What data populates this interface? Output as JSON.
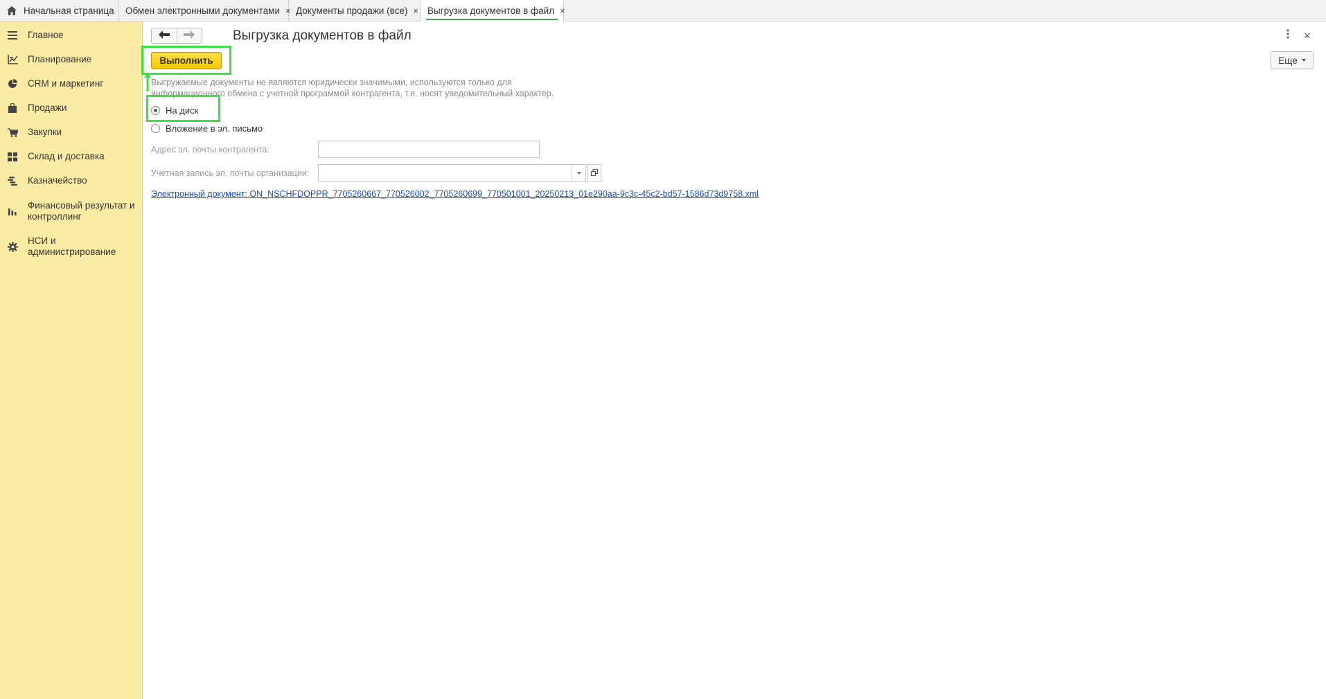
{
  "tabs": [
    {
      "label": "Начальная страница",
      "icon": "home-icon"
    },
    {
      "label": "Обмен электронными документами",
      "close": "×"
    },
    {
      "label": "Документы продажи (все)",
      "close": "×"
    },
    {
      "label": "Выгрузка документов в файл",
      "close": "×",
      "active": true
    }
  ],
  "sidebar": {
    "items": [
      {
        "label": "Главное",
        "icon": "menu-icon"
      },
      {
        "label": "Планирование",
        "icon": "planning-icon"
      },
      {
        "label": "CRM и маркетинг",
        "icon": "pie-chart-icon"
      },
      {
        "label": "Продажи",
        "icon": "shopping-bag-icon"
      },
      {
        "label": "Закупки",
        "icon": "cart-icon"
      },
      {
        "label": "Склад и доставка",
        "icon": "warehouse-grid-icon"
      },
      {
        "label": "Казначейство",
        "icon": "coins-icon"
      },
      {
        "label": "Финансовый результат и контроллинг",
        "icon": "bar-chart-icon"
      },
      {
        "label": "НСИ и администрирование",
        "icon": "gear-icon"
      }
    ]
  },
  "form": {
    "title": "Выгрузка документов в файл",
    "run_button": "Выполнить",
    "more_button": "Еще",
    "notice": "Выгружаемые документы не являются юридически значимыми, используются только для информационного обмена с учетной программой контрагента, т.е. носят уведомительный характер.",
    "options": [
      {
        "label": "На диск",
        "selected": true
      },
      {
        "label": "Вложение в эл. письмо",
        "selected": false
      }
    ],
    "email_label": "Адрес эл. почты контрагента:",
    "email_value": "",
    "account_label": "Учетная запись эл. почты организации:",
    "account_value": "",
    "document_link": "Электронный документ: ON_NSCHFDOPPR_7705260667_770526002_7705260699_770501001_20250213_01e290aa-9c3c-45c2-bd57-1586d73d9758.xml"
  },
  "colors": {
    "sidebar_bg": "#fbeca5",
    "highlight": "#3ee23e",
    "run_button": "#f3c800",
    "link": "#1c4fb8",
    "active_tab_underline": "#4aa04a"
  }
}
